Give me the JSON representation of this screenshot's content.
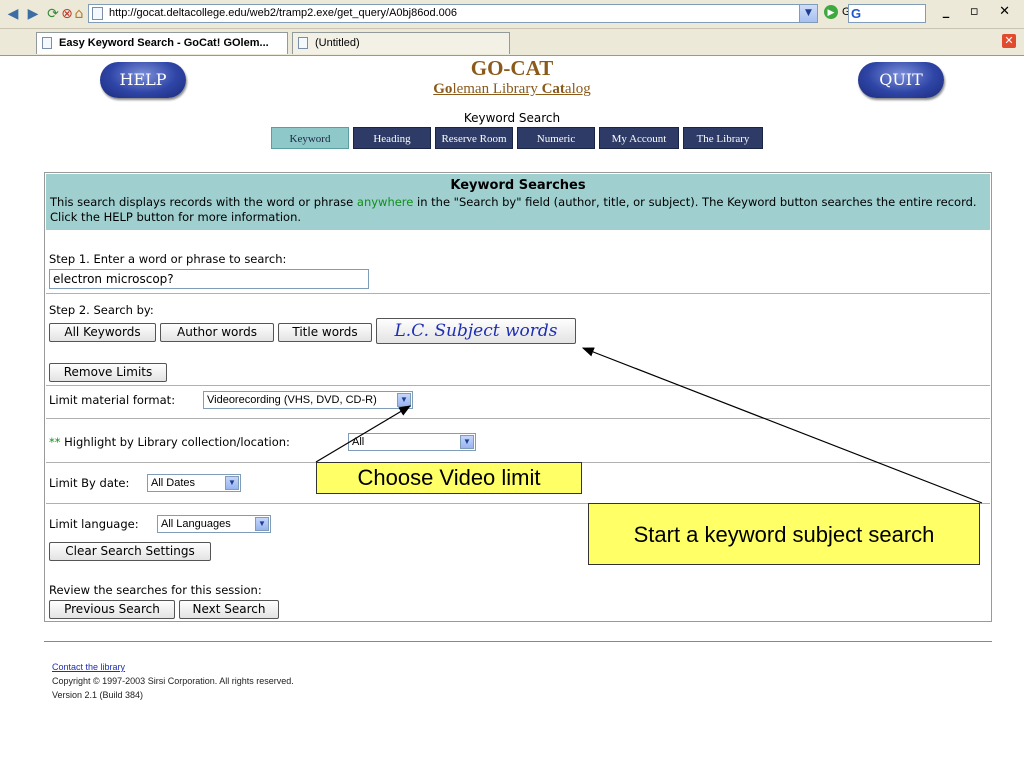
{
  "browser": {
    "address_url": "http://gocat.deltacollege.edu/web2/tramp2.exe/get_query/A0bj86od.006",
    "go_label": "Go",
    "google_letter": "G",
    "window_controls": "_ ▫ ✕"
  },
  "tabs": [
    {
      "label": "Easy Keyword Search - GoCat! GOlem..."
    },
    {
      "label": "(Untitled)"
    }
  ],
  "header": {
    "help_label": "HELP",
    "quit_label": "QUIT",
    "title": "GO-CAT",
    "subtitle_parts": [
      "Go",
      "leman Library ",
      "Cat",
      "alog"
    ],
    "search_mode": "Keyword Search"
  },
  "nav": [
    "Keyword",
    "Heading",
    "Reserve Room",
    "Numeric",
    "My Account",
    "The Library"
  ],
  "form": {
    "title": "Keyword Searches",
    "desc_before": "This search displays records with the word or phrase ",
    "desc_emph": "anywhere",
    "desc_after": " in the \"Search by\" field (author, title, or subject). The Keyword button searches the entire record. Click the HELP button for more information.",
    "step1_label": "Step 1. Enter a word or phrase to search:",
    "search_value": "electron microscop?",
    "step2_label": "Step 2. Search by:",
    "search_buttons": [
      "All Keywords",
      "Author words",
      "Title words",
      "L.C. Subject words"
    ],
    "remove_limits": "Remove Limits",
    "format_label": "Limit material format:",
    "format_value": "Videorecording (VHS, DVD, CD-R)",
    "highlight_stars": "**",
    "highlight_label": "Highlight by Library collection/location:",
    "highlight_value": "All",
    "date_label": "Limit By date:",
    "date_value": "All Dates",
    "language_label": "Limit language:",
    "language_value": "All Languages",
    "clear_settings": "Clear Search Settings",
    "review_label": "Review the searches for this session:",
    "previous_search": "Previous Search",
    "next_search": "Next Search"
  },
  "callouts": {
    "video": "Choose Video limit",
    "subject": "Start a keyword subject search"
  },
  "footer": {
    "contact": "Contact the library",
    "copyright": "Copyright © 1997-2003 Sirsi Corporation. All rights reserved.",
    "version": "Version 2.1 (Build 384)"
  },
  "colors": {
    "header_band": "#9fcfcf",
    "nav_bg": "#2d3b66",
    "nav_active": "#8ec8c8",
    "callout_fill": "#ffff66",
    "title_brown": "#8b5a1a",
    "emphasis_green": "#10901b"
  }
}
